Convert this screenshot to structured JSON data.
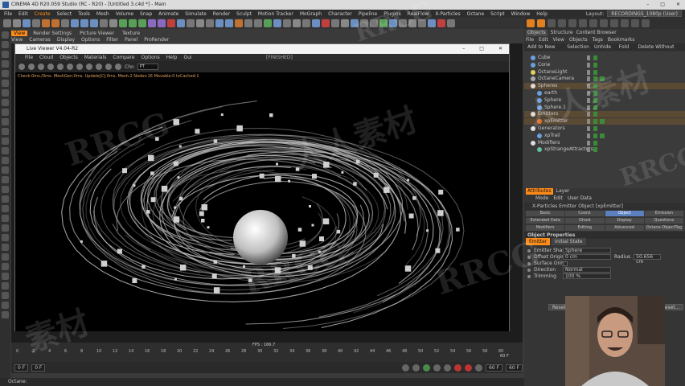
{
  "window": {
    "title": "CINEMA 4D R20.059 Studio (RC - R20) - [Untitled 3.c4d *] - Main",
    "controls": [
      "–",
      "□",
      "✕"
    ]
  },
  "menubar": [
    "File",
    "Edit",
    "Create",
    "Select",
    "Tools",
    "Mesh",
    "Volume",
    "Snap",
    "Animate",
    "Simulate",
    "Render",
    "Sculpt",
    "Motion Tracker",
    "MoGraph",
    "Character",
    "Pipeline",
    "Plugins",
    "RealFlow",
    "X-Particles",
    "Octane",
    "Script",
    "Window",
    "Help"
  ],
  "menubar_active": "Create",
  "layout": {
    "label": "Layout:",
    "value": "RECORDINGS_1080p (User)"
  },
  "view_tabs": [
    "View",
    "Render Settings",
    "Picture Viewer",
    "Texture"
  ],
  "view_menu": [
    "View",
    "Cameras",
    "Display",
    "Options",
    "Filter",
    "Panel",
    "ProRender"
  ],
  "live_viewer": {
    "title": "Live Viewer V4.04-R2",
    "menu": [
      "File",
      "Cloud",
      "Objects",
      "Materials",
      "Compare",
      "Options",
      "Help",
      "Gui"
    ],
    "status": "[FINISHED]",
    "channel_label": "Chn",
    "channel_value": "PT",
    "stats": "Check:0ms./0ms. MeshGen:0ms. Update[C]:0ms. Mesh:2 Nodes:16 Movable:0 txCached:1"
  },
  "timeline": {
    "fps": "FPS : 166.7",
    "ticks": [
      "0",
      "2",
      "4",
      "6",
      "8",
      "10",
      "12",
      "14",
      "16",
      "18",
      "20",
      "22",
      "24",
      "26",
      "28",
      "30",
      "32",
      "34",
      "36",
      "38",
      "40",
      "42",
      "44",
      "46",
      "48",
      "50",
      "52",
      "54",
      "56",
      "58",
      "60"
    ],
    "end_label": "60 F"
  },
  "playback": {
    "start": "0 F",
    "current": "0 F",
    "end": "60 F",
    "end2": "60 F"
  },
  "status_bar": "Octane:",
  "right_panel": {
    "tabs": [
      "Objects",
      "Structure",
      "Content Browser"
    ],
    "tab_active": "Objects",
    "menu": [
      "File",
      "Edit",
      "View",
      "Objects",
      "Tags",
      "Bookmarks"
    ],
    "layer_menu": [
      "Add to New Layer",
      "Selection",
      "Unhide All",
      "Fold All",
      "Delete Without Children"
    ],
    "objects": [
      {
        "name": "Cube",
        "indent": 0,
        "icon_color": "#6aa0e0",
        "tags": false,
        "selected": false
      },
      {
        "name": "Cone",
        "indent": 0,
        "icon_color": "#6aa0e0",
        "tags": false,
        "selected": false
      },
      {
        "name": "OctaneLight",
        "indent": 0,
        "icon_color": "#e0d060",
        "tags": false,
        "selected": false
      },
      {
        "name": "OctaneCamera",
        "indent": 0,
        "icon_color": "#aaaaaa",
        "tags": true,
        "selected": false
      },
      {
        "name": "Spheres",
        "indent": 0,
        "icon_color": "#dddddd",
        "tags": false,
        "selected": true
      },
      {
        "name": "earth",
        "indent": 1,
        "icon_color": "#6aa0e0",
        "tags": false,
        "selected": false
      },
      {
        "name": "Sphere",
        "indent": 1,
        "icon_color": "#6aa0e0",
        "tags": false,
        "selected": false
      },
      {
        "name": "Sphere.1",
        "indent": 1,
        "icon_color": "#6aa0e0",
        "tags": false,
        "selected": false
      },
      {
        "name": "Emitters",
        "indent": 0,
        "icon_color": "#dddddd",
        "tags": false,
        "selected": true
      },
      {
        "name": "xpEmitter",
        "indent": 1,
        "icon_color": "#e07030",
        "tags": true,
        "selected": true
      },
      {
        "name": "Generators",
        "indent": 0,
        "icon_color": "#dddddd",
        "tags": false,
        "selected": false
      },
      {
        "name": "xpTrail",
        "indent": 1,
        "icon_color": "#6aa0e0",
        "tags": true,
        "selected": false
      },
      {
        "name": "Modifiers",
        "indent": 0,
        "icon_color": "#dddddd",
        "tags": false,
        "selected": false
      },
      {
        "name": "xpStrangeAttractors",
        "indent": 1,
        "icon_color": "#60c0a0",
        "tags": false,
        "selected": false
      }
    ],
    "attr_tabs": [
      "Attributes",
      "Layer"
    ],
    "attr_active": "Attributes",
    "attr_menu": [
      "Mode",
      "Edit",
      "User Data"
    ],
    "attr_title": "X-Particles Emitter Object [xpEmitter]",
    "attr_grid": [
      "Basic",
      "Coord.",
      "Object",
      "Emission",
      "Extended Data",
      "Ghost",
      "Display",
      "Questions",
      "Modifiers",
      "Editing",
      "Advanced",
      "Octane ObjectTag"
    ],
    "attr_grid_active": "Object",
    "object_properties": "Object Properties",
    "sub_tabs": [
      "Emitter",
      "Initial State"
    ],
    "sub_active": "Emitter",
    "props": [
      {
        "label": "Emitter Shape",
        "value": "Sphere"
      },
      {
        "label": "Offset Origin",
        "value": "0 cm"
      },
      {
        "label": "Surface Only",
        "value": ""
      },
      {
        "label": "Direction",
        "value": "Normal"
      },
      {
        "label": "Trimming",
        "value": "100 %"
      }
    ],
    "radius_label": "Radius",
    "radius_value": "50.656 cm",
    "buttons": [
      "Reset to Default",
      "Save Preset...",
      "Load Preset..."
    ]
  },
  "watermarks": [
    "RRCG",
    "人人素材",
    "RRCG",
    "素材",
    "RRCG",
    "人人素材",
    "RRCG",
    "RRCG"
  ],
  "colors": {
    "accent": "#ff8c1a",
    "selection": "#5b7fbf",
    "bg": "#3a3a3a"
  }
}
